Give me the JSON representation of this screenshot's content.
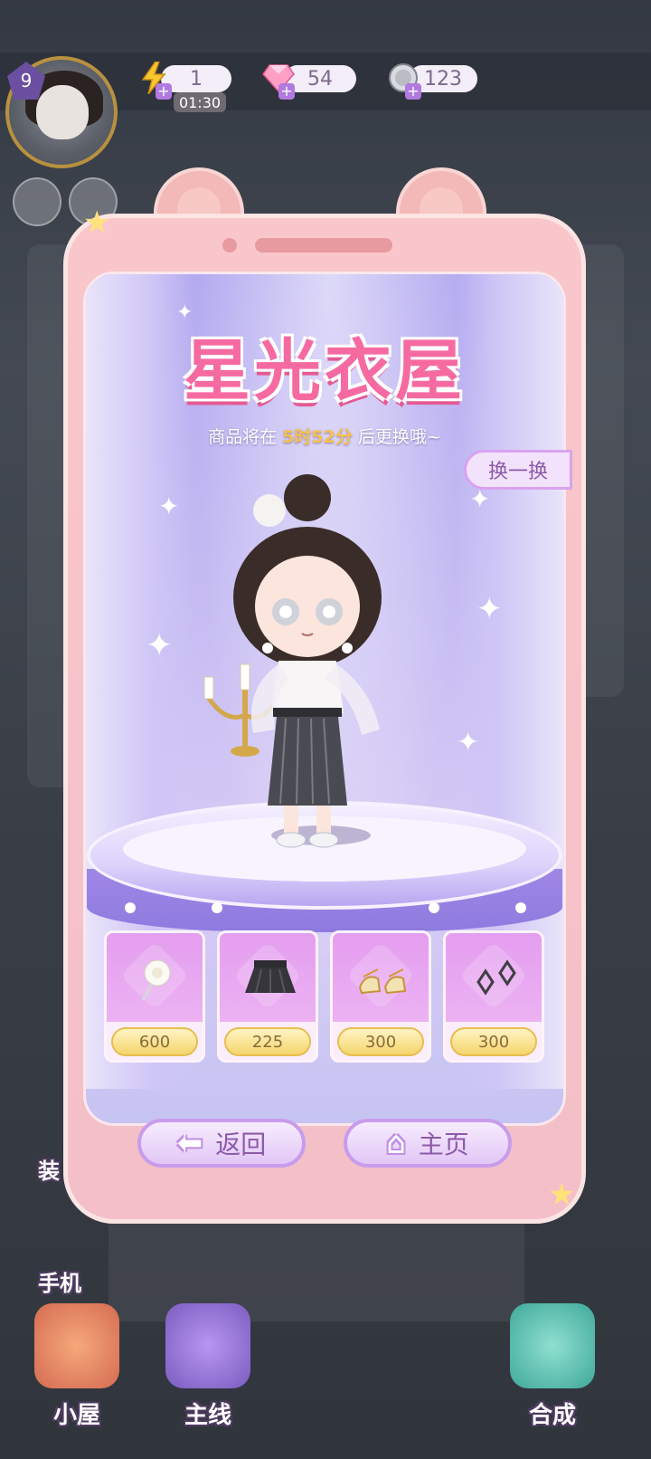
{
  "resources": {
    "energy": {
      "value": "1",
      "timer": "01:30",
      "icon": "lightning-icon"
    },
    "diamonds": {
      "value": "54",
      "icon": "diamond-icon"
    },
    "coins": {
      "value": "123",
      "icon": "coin-icon"
    }
  },
  "player": {
    "level": "9"
  },
  "shop": {
    "title": "星光衣屋",
    "refresh_prefix": "商品将在 ",
    "refresh_time": "5时52分",
    "refresh_suffix": " 后更换哦~",
    "swap_label": "换一换",
    "items": [
      {
        "name": "white-rose-hair-accessory",
        "price": "600",
        "currency": "coin"
      },
      {
        "name": "black-pleated-skirt",
        "price": "225",
        "currency": "diamond"
      },
      {
        "name": "gold-strap-shoes",
        "price": "300",
        "currency": "coin"
      },
      {
        "name": "diamond-earrings",
        "price": "300",
        "currency": "coin"
      }
    ]
  },
  "nav": {
    "back_label": "返回",
    "home_label": "主页"
  },
  "side": {
    "outfit_label": "装",
    "phone_label": "手机"
  },
  "dock": {
    "house_label": "小屋",
    "story_label": "主线",
    "merge_label": "合成"
  },
  "colors": {
    "title_pink": "#f66aa2",
    "accent_purple": "#c89cec",
    "gold": "#f4d56c"
  }
}
